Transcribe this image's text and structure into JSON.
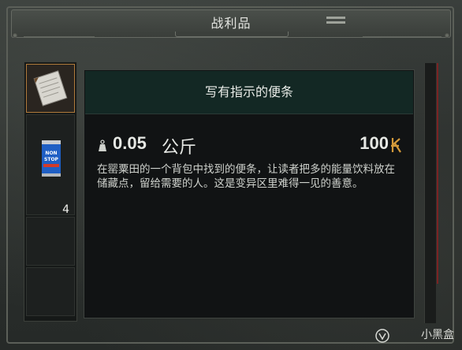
{
  "header": {
    "title": "战利品"
  },
  "inventory": {
    "slots": [
      {
        "icon": "note-icon",
        "selected": true,
        "count": ""
      },
      {
        "icon": "energy-drink-can-icon",
        "selected": false,
        "count": "4"
      },
      {
        "icon": "",
        "selected": false,
        "count": ""
      },
      {
        "icon": "",
        "selected": false,
        "count": ""
      }
    ]
  },
  "item": {
    "name": "写有指示的便条",
    "weight_value": "0.05",
    "weight_unit": "公斤",
    "price": "100",
    "description": "在罂粟田的一个背包中找到的便条，让读者把多的能量饮料放在储藏点，留给需要的人。这是变异区里难得一见的善意。"
  },
  "watermark": {
    "text": "小黑盒"
  },
  "colors": {
    "title_bar_bg": "#132824",
    "panel_bg": "#111314",
    "currency_accent": "#d49a3a",
    "selected_slot_border": "#b07a3a"
  }
}
